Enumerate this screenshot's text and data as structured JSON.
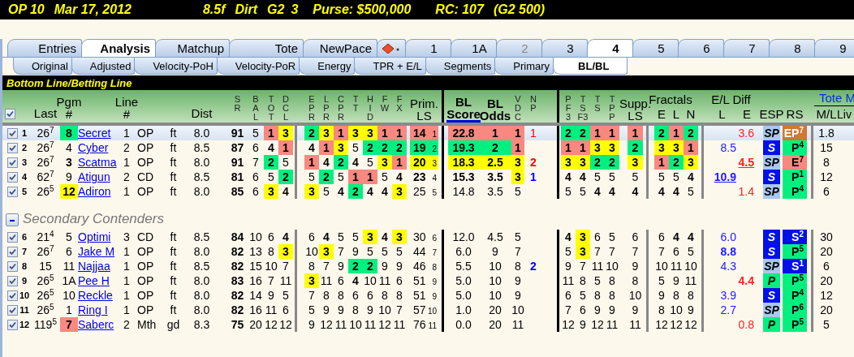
{
  "race_bar": [
    "OP 10",
    "Mar 17, 2012",
    "8.5f",
    "Dirt",
    "G2",
    "3",
    "Purse: $500,000",
    "RC: 107",
    "(G2 500)"
  ],
  "tabs": [
    {
      "kind": "text",
      "label": "Entries",
      "selected": false,
      "disabled": false
    },
    {
      "kind": "text",
      "label": "Analysis",
      "selected": true,
      "disabled": false
    },
    {
      "kind": "text",
      "label": "Matchup",
      "selected": false,
      "disabled": false
    },
    {
      "kind": "text",
      "label": "Tote",
      "selected": false,
      "disabled": false
    },
    {
      "kind": "text",
      "label": "NewPace",
      "selected": false,
      "disabled": false
    },
    {
      "kind": "icon",
      "selected": false,
      "disabled": false
    },
    {
      "kind": "race",
      "label": "1",
      "selected": false,
      "disabled": false
    },
    {
      "kind": "race",
      "label": "1A",
      "selected": false,
      "disabled": false
    },
    {
      "kind": "race",
      "label": "2",
      "selected": false,
      "disabled": true
    },
    {
      "kind": "race",
      "label": "3",
      "selected": false,
      "disabled": false
    },
    {
      "kind": "race",
      "label": "4",
      "selected": true,
      "disabled": false
    },
    {
      "kind": "race",
      "label": "5",
      "selected": false,
      "disabled": false
    },
    {
      "kind": "race",
      "label": "6",
      "selected": false,
      "disabled": false
    },
    {
      "kind": "race",
      "label": "7",
      "selected": false,
      "disabled": false
    },
    {
      "kind": "race",
      "label": "8",
      "selected": false,
      "disabled": false
    },
    {
      "kind": "race",
      "label": "9",
      "selected": false,
      "disabled": false
    }
  ],
  "subtabs": [
    {
      "label": "Original",
      "selected": false
    },
    {
      "label": "Adjusted",
      "selected": false
    },
    {
      "label": "Velocity-PoH",
      "selected": false
    },
    {
      "label": "Velocity-PoR",
      "selected": false
    },
    {
      "label": "Energy",
      "selected": false
    },
    {
      "label": "TPR + E/L",
      "selected": false
    },
    {
      "label": "Segments",
      "selected": false
    },
    {
      "label": "Primary",
      "selected": false
    },
    {
      "label": "BL/BL",
      "selected": true
    }
  ],
  "banner": "Bottom Line/Betting Line",
  "header": {
    "checked": true,
    "last": "Last",
    "pgm": "Pgm\n#",
    "line": "Line\n#",
    "dist": "Dist",
    "sr": "S\nR",
    "bal": "B\nA\nL",
    "tot": "T\nO\nT",
    "dcl": "D\nC\nL",
    "pace": [
      "E\nP\nR",
      "L\nP\nR",
      "C\nP\nR",
      "T\nT",
      "H\nI\nD",
      "F\nW",
      "F\nX"
    ],
    "prim": "Prim.\nLS",
    "bl_score": {
      "label": "BL\nScore",
      "sorted": true
    },
    "bl_odds": {
      "label": "BL\nOdds",
      "sorted": false
    },
    "vdc": "V\nD\nC",
    "np": "N\nP",
    "pf": [
      "P\nF\n3",
      "T\nS\nF3",
      "T\nS",
      "T\nP\nP"
    ],
    "supp": "Supp.\nLS",
    "fractals": "Fractals",
    "fr": [
      "E",
      "L",
      "N"
    ],
    "el": "E/L Diff",
    "el_sub": [
      "L",
      "E"
    ],
    "esp": "ESP",
    "rs": "RS",
    "tote": "Tote M",
    "ml": "M/L",
    "live": "Liv"
  },
  "rows": [
    {
      "num": "1",
      "checked": true,
      "selected": true,
      "last": "26$^{7}$",
      "pgm": {
        "value": "8",
        "bold": true,
        "color": "#00f080"
      },
      "name": "Secret",
      "line": "1",
      "track": "OP",
      "surface": "ft",
      "dist": "8.0",
      "sr": "91",
      "bal": "5",
      "tot": {
        "value": "1",
        "bold": true,
        "color": "#f88880"
      },
      "dcl": {
        "value": "3",
        "bold": true,
        "color": "#ffff00"
      },
      "pace": [
        {
          "value": "2",
          "bold": true,
          "color": "#00f080"
        },
        {
          "value": "3",
          "bold": true,
          "color": "#ffff00"
        },
        {
          "value": "1",
          "bold": true,
          "color": "#f88880"
        },
        {
          "value": "3",
          "bold": true,
          "color": "#ffff00"
        },
        {
          "value": "3",
          "bold": true,
          "color": "#ffff00"
        },
        {
          "value": "1",
          "bold": true,
          "color": "#f88880"
        },
        {
          "value": "1",
          "bold": true,
          "color": "#f88880"
        }
      ],
      "prim": {
        "value": "14",
        "rank": "1",
        "bold": true,
        "color": "#f88880"
      },
      "bl_score": {
        "value": "22.8",
        "bold": true,
        "color": "#f88880"
      },
      "bl_odds": {
        "value": "1",
        "bold": true,
        "color": "#f88880"
      },
      "vdc": {
        "value": "1",
        "bold": true,
        "color": "#f88880"
      },
      "np": {
        "value": "1",
        "bold": false,
        "color": "#ff0000"
      },
      "pf": [
        {
          "value": "2",
          "bold": true,
          "color": "#00f080"
        },
        {
          "value": "2",
          "bold": true,
          "color": "#00f080"
        },
        {
          "value": "1",
          "bold": true,
          "color": "#f88880"
        },
        {
          "value": "1",
          "bold": true,
          "color": "#f88880"
        }
      ],
      "supp": {
        "value": "1",
        "bold": true,
        "color": "#f88880"
      },
      "fr": [
        {
          "value": "2",
          "bold": true,
          "color": "#00f080"
        },
        {
          "value": "1",
          "bold": true,
          "color": "#f88880"
        },
        {
          "value": "2",
          "bold": true,
          "color": "#00f080"
        }
      ],
      "el_e": {
        "value": "3.6",
        "bold": false,
        "link": false
      },
      "esp": {
        "value": "SP",
        "color": "#a8c8f0"
      },
      "rs": {
        "value": "EP$^{7}$",
        "color": "#d07830"
      },
      "ml": "1.8"
    },
    {
      "num": "2",
      "checked": true,
      "selected": false,
      "last": "26$^{7}$",
      "pgm": {
        "value": "4",
        "bold": false
      },
      "name": "Cyber",
      "line": "2",
      "track": "OP",
      "surface": "ft",
      "dist": "8.5",
      "sr": "87",
      "bal": "6",
      "tot": {
        "value": "4",
        "bold": true
      },
      "dcl": {
        "value": "1",
        "bold": true,
        "color": "#f88880"
      },
      "pace": [
        {
          "value": "4",
          "bold": true
        },
        {
          "value": "1",
          "bold": true,
          "color": "#f88880"
        },
        {
          "value": "3",
          "bold": true,
          "color": "#ffff00"
        },
        {
          "value": "5",
          "bold": false
        },
        {
          "value": "2",
          "bold": true,
          "color": "#00f080"
        },
        {
          "value": "2",
          "bold": true,
          "color": "#00f080"
        },
        {
          "value": "2",
          "bold": true,
          "color": "#00f080"
        }
      ],
      "prim": {
        "value": "19",
        "rank": "2",
        "bold": true,
        "color": "#00f080"
      },
      "bl_score": {
        "value": "19.3",
        "bold": true,
        "color": "#00f080"
      },
      "bl_odds": {
        "value": "2",
        "bold": true,
        "color": "#00f080"
      },
      "vdc": {
        "value": "1",
        "bold": true,
        "color": "#f88880"
      },
      "pf": [
        {
          "value": "1",
          "bold": true,
          "color": "#f88880"
        },
        {
          "value": "1",
          "bold": true,
          "color": "#f88880"
        },
        {
          "value": "3",
          "bold": true,
          "color": "#ffff00"
        },
        {
          "value": "3",
          "bold": true,
          "color": "#ffff00"
        }
      ],
      "supp": {
        "value": "2",
        "bold": true,
        "color": "#00f080"
      },
      "fr": [
        {
          "value": "3",
          "bold": true,
          "color": "#ffff00"
        },
        {
          "value": "3",
          "bold": true,
          "color": "#ffff00"
        },
        {
          "value": "1",
          "bold": true,
          "color": "#f88880"
        }
      ],
      "el_l": {
        "value": "8.5",
        "bold": false,
        "link": false
      },
      "esp": {
        "value": "S",
        "color": "#0010e8"
      },
      "rs": {
        "value": "P$^{4}$",
        "color": "#00f080"
      },
      "ml": "15"
    },
    {
      "num": "3",
      "checked": true,
      "selected": false,
      "last": "26$^{7}$",
      "pgm": {
        "value": "3",
        "bold": true
      },
      "name": "Scatma",
      "line": "1",
      "track": "OP",
      "surface": "ft",
      "dist": "8.0",
      "sr": "91",
      "bal": "7",
      "tot": {
        "value": "2",
        "bold": true,
        "color": "#00f080"
      },
      "dcl": {
        "value": "5",
        "bold": false
      },
      "pace": [
        {
          "value": "1",
          "bold": true,
          "color": "#f88880"
        },
        {
          "value": "4",
          "bold": true
        },
        {
          "value": "2",
          "bold": true,
          "color": "#00f080"
        },
        {
          "value": "4",
          "bold": true
        },
        {
          "value": "5",
          "bold": false
        },
        {
          "value": "3",
          "bold": true,
          "color": "#ffff00"
        },
        {
          "value": "1",
          "bold": true,
          "color": "#f88880"
        }
      ],
      "prim": {
        "value": "20",
        "rank": "3",
        "bold": true,
        "color": "#ffff00"
      },
      "bl_score": {
        "value": "18.3",
        "bold": true,
        "color": "#ffff00"
      },
      "bl_odds": {
        "value": "2.5",
        "bold": true,
        "color": "#ffff00"
      },
      "vdc": {
        "value": "3",
        "bold": true,
        "color": "#ffff00"
      },
      "np": {
        "value": "2",
        "bold": true,
        "color": "#ff0000"
      },
      "pf": [
        {
          "value": "3",
          "bold": true,
          "color": "#ffff00"
        },
        {
          "value": "3",
          "bold": true,
          "color": "#ffff00"
        },
        {
          "value": "2",
          "bold": true,
          "color": "#00f080"
        },
        {
          "value": "2",
          "bold": true,
          "color": "#00f080"
        }
      ],
      "supp": {
        "value": "3",
        "bold": true,
        "color": "#ffff00"
      },
      "fr": [
        {
          "value": "1",
          "bold": true,
          "color": "#f88880"
        },
        {
          "value": "2",
          "bold": true,
          "color": "#00f080"
        },
        {
          "value": "3",
          "bold": true,
          "color": "#ffff00"
        }
      ],
      "el_e": {
        "value": "4.5",
        "bold": true,
        "link": true
      },
      "esp": {
        "value": "SP",
        "color": "#a8c8f0"
      },
      "rs": {
        "value": "E$^{7}$",
        "color": "#f88880"
      },
      "ml": "8"
    },
    {
      "num": "4",
      "checked": true,
      "selected": false,
      "last": "62$^{7}$",
      "pgm": {
        "value": "9",
        "bold": false
      },
      "name": "Atigun",
      "line": "2",
      "track": "CD",
      "surface": "ft",
      "dist": "8.5",
      "sr": "81",
      "bal": "6",
      "tot": {
        "value": "5",
        "bold": false
      },
      "dcl": {
        "value": "2",
        "bold": true,
        "color": "#00f080"
      },
      "pace": [
        {
          "value": "5",
          "bold": false
        },
        {
          "value": "2",
          "bold": true,
          "color": "#00f080"
        },
        {
          "value": "5",
          "bold": false
        },
        {
          "value": "1",
          "bold": true,
          "color": "#f88880"
        },
        {
          "value": "1",
          "bold": true,
          "color": "#f88880"
        },
        {
          "value": "5",
          "bold": false
        },
        {
          "value": "4",
          "bold": true
        }
      ],
      "prim": {
        "value": "23",
        "rank": "4",
        "bold": true
      },
      "bl_score": {
        "value": "15.3",
        "bold": true
      },
      "bl_odds": {
        "value": "3.5",
        "bold": true
      },
      "vdc": {
        "value": "3",
        "bold": true,
        "color": "#ffff00"
      },
      "np": {
        "value": "1",
        "bold": true,
        "color": "#0000ff"
      },
      "pf": [
        {
          "value": "4",
          "bold": true
        },
        {
          "value": "4",
          "bold": true
        },
        {
          "value": "5",
          "bold": false
        },
        {
          "value": "5",
          "bold": false
        }
      ],
      "supp": {
        "value": "5",
        "bold": false
      },
      "fr": [
        {
          "value": "5",
          "bold": false
        },
        {
          "value": "5",
          "bold": false
        },
        {
          "value": "4",
          "bold": true
        }
      ],
      "el_l": {
        "value": "10.9",
        "bold": true,
        "link": true
      },
      "esp": {
        "value": "S",
        "color": "#0010e8"
      },
      "rs": {
        "value": "P$^{1}$",
        "color": "#00f080"
      },
      "ml": "12"
    },
    {
      "num": "5",
      "checked": true,
      "selected": false,
      "last": "26$^{5}$",
      "pgm": {
        "value": "12",
        "bold": true,
        "color": "#ffff00"
      },
      "name": "Adiron",
      "line": "1",
      "track": "OP",
      "surface": "ft",
      "dist": "8.0",
      "sr": "85",
      "bal": "6",
      "tot": {
        "value": "3",
        "bold": true,
        "color": "#ffff00"
      },
      "dcl": {
        "value": "4",
        "bold": true
      },
      "pace": [
        {
          "value": "3",
          "bold": true,
          "color": "#ffff00"
        },
        {
          "value": "5",
          "bold": false
        },
        {
          "value": "4",
          "bold": true
        },
        {
          "value": "2",
          "bold": true,
          "color": "#00f080"
        },
        {
          "value": "4",
          "bold": true
        },
        {
          "value": "4",
          "bold": true
        },
        {
          "value": "3",
          "bold": true,
          "color": "#ffff00"
        }
      ],
      "prim": {
        "value": "25",
        "rank": "5",
        "bold": false
      },
      "bl_score": {
        "value": "14.8",
        "bold": false
      },
      "bl_odds": {
        "value": "3.5",
        "bold": false
      },
      "vdc": {
        "value": "5",
        "bold": false
      },
      "pf": [
        {
          "value": "5",
          "bold": false
        },
        {
          "value": "5",
          "bold": false
        },
        {
          "value": "4",
          "bold": true
        },
        {
          "value": "4",
          "bold": true
        }
      ],
      "supp": {
        "value": "4",
        "bold": true
      },
      "fr": [
        {
          "value": "4",
          "bold": true
        },
        {
          "value": "4",
          "bold": true
        },
        {
          "value": "5",
          "bold": false
        }
      ],
      "el_e": {
        "value": "1.4",
        "bold": false,
        "link": false
      },
      "esp": {
        "value": "SP",
        "color": "#a8c8f0"
      },
      "rs": {
        "value": "P$^{4}$",
        "color": "#00f080"
      },
      "ml": "6"
    }
  ],
  "secondary": {
    "title": "Secondary Contenders",
    "expanded": true,
    "rows": [
      {
        "num": "6",
        "checked": true,
        "selected": false,
        "last": "21$^{4}$",
        "pgm": {
          "value": "5",
          "bold": false
        },
        "name": "Optimi",
        "line": "3",
        "track": "CD",
        "surface": "ft",
        "dist": "8.5",
        "sr": "84",
        "bal": "10",
        "tot": {
          "value": "6",
          "bold": false
        },
        "dcl": {
          "value": "4",
          "bold": true
        },
        "pace": [
          {
            "value": "6",
            "bold": false
          },
          {
            "value": "4",
            "bold": true
          },
          {
            "value": "5",
            "bold": false
          },
          {
            "value": "5",
            "bold": false
          },
          {
            "value": "3",
            "bold": true,
            "color": "#ffff00"
          },
          {
            "value": "4",
            "bold": true
          },
          {
            "value": "3",
            "bold": true,
            "color": "#ffff00"
          }
        ],
        "prim": {
          "value": "30",
          "rank": "6",
          "bold": false
        },
        "bl_score": {
          "value": "12.0",
          "bold": false
        },
        "bl_odds": {
          "value": "4.5",
          "bold": false
        },
        "vdc": {
          "value": "5",
          "bold": false
        },
        "pf": [
          {
            "value": "4",
            "bold": true
          },
          {
            "value": "3",
            "bold": true,
            "color": "#ffff00"
          },
          {
            "value": "6",
            "bold": false
          },
          {
            "value": "5",
            "bold": false
          }
        ],
        "supp": {
          "value": "6",
          "bold": false
        },
        "fr": [
          {
            "value": "6",
            "bold": false
          },
          {
            "value": "4",
            "bold": true
          },
          {
            "value": "4",
            "bold": true
          }
        ],
        "el_l": {
          "value": "6.0",
          "bold": false,
          "link": false
        },
        "esp": {
          "value": "S",
          "color": "#0010e8"
        },
        "rs": {
          "value": "S$^{2}$",
          "color": "#0010e8"
        },
        "ml": "30"
      },
      {
        "num": "7",
        "checked": true,
        "selected": false,
        "last": "26$^{7}$",
        "pgm": {
          "value": "6",
          "bold": false
        },
        "name": "Jake M",
        "line": "1",
        "track": "OP",
        "surface": "ft",
        "dist": "8.0",
        "sr": "82",
        "bal": "13",
        "tot": {
          "value": "8",
          "bold": false
        },
        "dcl": {
          "value": "3",
          "bold": true,
          "color": "#ffff00"
        },
        "pace": [
          {
            "value": "10",
            "bold": false
          },
          {
            "value": "3",
            "bold": true,
            "color": "#ffff00"
          },
          {
            "value": "7",
            "bold": false
          },
          {
            "value": "9",
            "bold": false
          },
          {
            "value": "5",
            "bold": false
          },
          {
            "value": "5",
            "bold": false
          },
          {
            "value": "5",
            "bold": false
          }
        ],
        "prim": {
          "value": "44",
          "rank": "7",
          "bold": false
        },
        "bl_score": {
          "value": "6.0",
          "bold": false
        },
        "bl_odds": {
          "value": "9",
          "bold": false
        },
        "vdc": {
          "value": "7",
          "bold": false
        },
        "pf": [
          {
            "value": "5",
            "bold": false
          },
          {
            "value": "3",
            "bold": true,
            "color": "#ffff00"
          },
          {
            "value": "7",
            "bold": false
          },
          {
            "value": "7",
            "bold": false
          }
        ],
        "supp": {
          "value": "7",
          "bold": false
        },
        "fr": [
          {
            "value": "7",
            "bold": false
          },
          {
            "value": "6",
            "bold": false
          },
          {
            "value": "5",
            "bold": false
          }
        ],
        "el_l": {
          "value": "8.8",
          "bold": true,
          "link": false
        },
        "esp": {
          "value": "S",
          "color": "#0010e8"
        },
        "rs": {
          "value": "P$^{5}$",
          "color": "#00f080"
        },
        "ml": "20"
      },
      {
        "num": "8",
        "checked": true,
        "selected": false,
        "last": "15",
        "pgm": {
          "value": "11",
          "bold": false
        },
        "name": "Najjaa",
        "line": "1",
        "track": "OP",
        "surface": "ft",
        "dist": "8.5",
        "sr": "82",
        "bal": "15",
        "tot": {
          "value": "10",
          "bold": false
        },
        "dcl": {
          "value": "7",
          "bold": false
        },
        "pace": [
          {
            "value": "8",
            "bold": false
          },
          {
            "value": "7",
            "bold": false
          },
          {
            "value": "9",
            "bold": false
          },
          {
            "value": "2",
            "bold": true,
            "color": "#00f080"
          },
          {
            "value": "2",
            "bold": true,
            "color": "#00f080"
          },
          {
            "value": "9",
            "bold": false
          },
          {
            "value": "9",
            "bold": false
          }
        ],
        "prim": {
          "value": "46",
          "rank": "8",
          "bold": false
        },
        "bl_score": {
          "value": "5.5",
          "bold": false
        },
        "bl_odds": {
          "value": "10",
          "bold": false
        },
        "vdc": {
          "value": "8",
          "bold": false
        },
        "np": {
          "value": "2",
          "bold": true,
          "color": "#0000ff"
        },
        "pf": [
          {
            "value": "9",
            "bold": false
          },
          {
            "value": "7",
            "bold": false
          },
          {
            "value": "11",
            "bold": false
          },
          {
            "value": "10",
            "bold": false
          }
        ],
        "supp": {
          "value": "9",
          "bold": false
        },
        "fr": [
          {
            "value": "10",
            "bold": false
          },
          {
            "value": "11",
            "bold": false
          },
          {
            "value": "10",
            "bold": false
          }
        ],
        "el_l": {
          "value": "4.3",
          "bold": false,
          "link": false
        },
        "esp": {
          "value": "SP",
          "color": "#a8c8f0"
        },
        "rs": {
          "value": "S$^{1}$",
          "color": "#0010e8"
        },
        "ml": "6"
      },
      {
        "num": "9",
        "checked": true,
        "selected": false,
        "last": "26$^{5}$",
        "pgm": {
          "value": "1A",
          "bold": false
        },
        "name": "Pee H",
        "line": "1",
        "track": "OP",
        "surface": "ft",
        "dist": "8.0",
        "sr": "83",
        "bal": "16",
        "tot": {
          "value": "7",
          "bold": false
        },
        "dcl": {
          "value": "11",
          "bold": false
        },
        "pace": [
          {
            "value": "3",
            "bold": true,
            "color": "#ffff00"
          },
          {
            "value": "11",
            "bold": false
          },
          {
            "value": "6",
            "bold": false
          },
          {
            "value": "4",
            "bold": true
          },
          {
            "value": "10",
            "bold": false
          },
          {
            "value": "11",
            "bold": false
          },
          {
            "value": "6",
            "bold": false
          }
        ],
        "prim": {
          "value": "51",
          "rank": "9",
          "bold": false
        },
        "bl_score": {
          "value": "5.0",
          "bold": false
        },
        "bl_odds": {
          "value": "10",
          "bold": false
        },
        "vdc": {
          "value": "9",
          "bold": false
        },
        "pf": [
          {
            "value": "11",
            "bold": false
          },
          {
            "value": "8",
            "bold": false
          },
          {
            "value": "5",
            "bold": false
          },
          {
            "value": "8",
            "bold": false
          }
        ],
        "supp": {
          "value": "8",
          "bold": false
        },
        "fr": [
          {
            "value": "5",
            "bold": false
          },
          {
            "value": "9",
            "bold": false
          },
          {
            "value": "11",
            "bold": false
          }
        ],
        "el_e": {
          "value": "4.4",
          "bold": true,
          "link": false
        },
        "esp": {
          "value": "P",
          "color": "#00f080"
        },
        "rs": {
          "value": "P$^{5}$",
          "color": "#00f080"
        },
        "ml": "20"
      },
      {
        "num": "10",
        "checked": true,
        "selected": false,
        "last": "26$^{5}$",
        "pgm": {
          "value": "10",
          "bold": false
        },
        "name": "Reckle",
        "line": "1",
        "track": "OP",
        "surface": "ft",
        "dist": "8.0",
        "sr": "82",
        "bal": "14",
        "tot": {
          "value": "9",
          "bold": false
        },
        "dcl": {
          "value": "5",
          "bold": false
        },
        "pace": [
          {
            "value": "7",
            "bold": false
          },
          {
            "value": "8",
            "bold": false
          },
          {
            "value": "8",
            "bold": false
          },
          {
            "value": "6",
            "bold": false
          },
          {
            "value": "6",
            "bold": false
          },
          {
            "value": "8",
            "bold": false
          },
          {
            "value": "8",
            "bold": false
          }
        ],
        "prim": {
          "value": "51",
          "rank": "9",
          "bold": false
        },
        "bl_score": {
          "value": "5.0",
          "bold": false
        },
        "bl_odds": {
          "value": "10",
          "bold": false
        },
        "vdc": {
          "value": "9",
          "bold": false
        },
        "pf": [
          {
            "value": "6",
            "bold": false
          },
          {
            "value": "5",
            "bold": false
          },
          {
            "value": "8",
            "bold": false
          },
          {
            "value": "8",
            "bold": false
          }
        ],
        "supp": {
          "value": "10",
          "bold": false
        },
        "fr": [
          {
            "value": "9",
            "bold": false
          },
          {
            "value": "8",
            "bold": false
          },
          {
            "value": "8",
            "bold": false
          }
        ],
        "el_l": {
          "value": "3.9",
          "bold": false,
          "link": false
        },
        "esp": {
          "value": "S",
          "color": "#0010e8"
        },
        "rs": {
          "value": "P$^{4}$",
          "color": "#00f080"
        },
        "ml": "12"
      },
      {
        "num": "11",
        "checked": true,
        "selected": false,
        "last": "26$^{5}$",
        "pgm": {
          "value": "1",
          "bold": false
        },
        "name": "Ring I",
        "line": "1",
        "track": "OP",
        "surface": "ft",
        "dist": "8.0",
        "sr": "82",
        "bal": "16",
        "tot": {
          "value": "11",
          "bold": false
        },
        "dcl": {
          "value": "6",
          "bold": false
        },
        "pace": [
          {
            "value": "5",
            "bold": false
          },
          {
            "value": "9",
            "bold": false
          },
          {
            "value": "9",
            "bold": false
          },
          {
            "value": "8",
            "bold": false
          },
          {
            "value": "9",
            "bold": false
          },
          {
            "value": "10",
            "bold": false
          },
          {
            "value": "7",
            "bold": false
          }
        ],
        "prim": {
          "value": "57",
          "rank": "10",
          "bold": false
        },
        "bl_score": {
          "value": "1.0",
          "bold": false
        },
        "bl_odds": {
          "value": "20",
          "bold": false
        },
        "vdc": {
          "value": "10",
          "bold": false
        },
        "pf": [
          {
            "value": "7",
            "bold": false
          },
          {
            "value": "6",
            "bold": false
          },
          {
            "value": "9",
            "bold": false
          },
          {
            "value": "9",
            "bold": false
          }
        ],
        "supp": {
          "value": "9",
          "bold": false
        },
        "fr": [
          {
            "value": "8",
            "bold": false
          },
          {
            "value": "10",
            "bold": false
          },
          {
            "value": "9",
            "bold": false
          }
        ],
        "el_l": {
          "value": "2.7",
          "bold": false,
          "link": false
        },
        "esp": {
          "value": "SP",
          "color": "#a8c8f0"
        },
        "rs": {
          "value": "P$^{6}$",
          "color": "#00f080"
        },
        "ml": "20"
      },
      {
        "num": "12",
        "checked": true,
        "selected": false,
        "last": "119$^{5}$",
        "pgm": {
          "value": "7",
          "bold": true,
          "color": "#f88880"
        },
        "name": "Saberc",
        "line": "2",
        "track": "Mth",
        "surface": "gd",
        "dist": "8.3",
        "sr": "75",
        "bal": "20",
        "tot": {
          "value": "12",
          "bold": false
        },
        "dcl": {
          "value": "12",
          "bold": false
        },
        "pace": [
          {
            "value": "9",
            "bold": false
          },
          {
            "value": "12",
            "bold": false
          },
          {
            "value": "11",
            "bold": false
          },
          {
            "value": "10",
            "bold": false
          },
          {
            "value": "11",
            "bold": false
          },
          {
            "value": "12",
            "bold": false
          },
          {
            "value": "11",
            "bold": false
          }
        ],
        "prim": {
          "value": "76",
          "rank": "11",
          "bold": false
        },
        "bl_score": {
          "value": "0.0",
          "bold": false
        },
        "bl_odds": {
          "value": "20",
          "bold": false
        },
        "vdc": {
          "value": "11",
          "bold": false
        },
        "pf": [
          {
            "value": "12",
            "bold": false
          },
          {
            "value": "9",
            "bold": false
          },
          {
            "value": "12",
            "bold": false
          },
          {
            "value": "11",
            "bold": false
          }
        ],
        "supp": {
          "value": "11",
          "bold": false
        },
        "fr": [
          {
            "value": "12",
            "bold": false
          },
          {
            "value": "12",
            "bold": false
          },
          {
            "value": "12",
            "bold": false
          }
        ],
        "el_e": {
          "value": "0.8",
          "bold": false,
          "link": false
        },
        "esp": {
          "value": "P",
          "color": "#00f080"
        },
        "rs": {
          "value": "P$^{5}$",
          "color": "#00f080"
        },
        "ml": "5"
      }
    ]
  }
}
